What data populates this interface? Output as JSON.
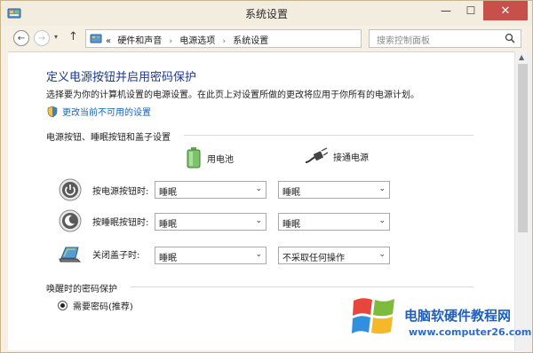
{
  "window": {
    "title": "系统设置",
    "controls": {
      "minimize": "—",
      "maximize": "☐",
      "close": "✕"
    }
  },
  "addressbar": {
    "back_icon": "←",
    "forward_icon": "→",
    "dropdown_icon": "▾",
    "up_icon": "↑",
    "breadcrumb_prefix": "«",
    "breadcrumbs": [
      "硬件和声音",
      "电源选项",
      "系统设置"
    ],
    "breadcrumb_separator": "›",
    "refresh_icon": "↻",
    "search_placeholder": "搜索控制面板"
  },
  "main": {
    "heading": "定义电源按钮并启用密码保护",
    "description": "选择要为你的计算机设置的电源设置。在此页上对设置所做的更改将应用于你所有的电源计划。",
    "change_link": "更改当前不可用的设置",
    "section_buttons": "电源按钮、睡眠按钮和盖子设置",
    "columns": {
      "battery": "用电池",
      "plugged": "接通电源"
    },
    "rows": [
      {
        "label": "按电源按钮时:",
        "battery": "睡眠",
        "plugged": "睡眠",
        "icon": "power-button-icon"
      },
      {
        "label": "按睡眠按钮时:",
        "battery": "睡眠",
        "plugged": "睡眠",
        "icon": "sleep-button-icon"
      },
      {
        "label": "关闭盖子时:",
        "battery": "睡眠",
        "plugged": "不采取任何操作",
        "icon": "laptop-lid-icon"
      }
    ],
    "section_password": "唤醒时的密码保护",
    "radio_require_password": "需要密码(推荐)"
  },
  "watermark": {
    "title": "电脑软硬件教程网",
    "url": "www.computer26.com"
  },
  "colors": {
    "heading": "#1e3a8a",
    "link": "#1565c0",
    "close_button": "#c7504b",
    "frame": "#f6f0e4"
  }
}
